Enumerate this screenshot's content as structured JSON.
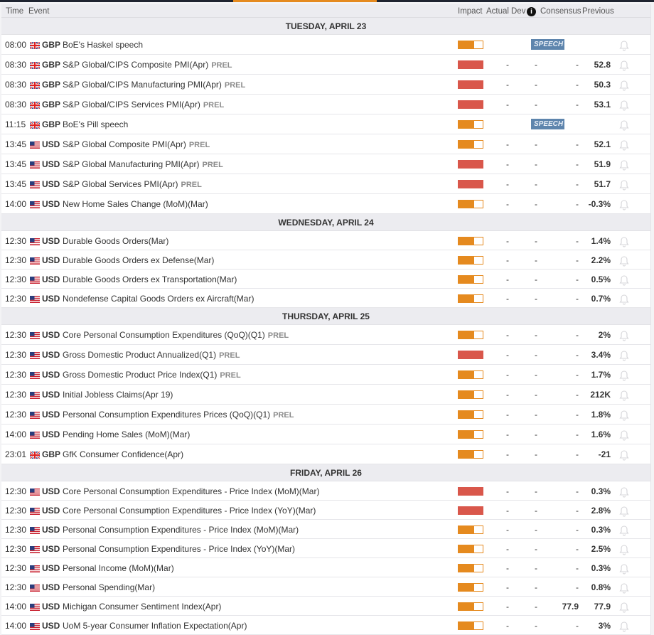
{
  "header": {
    "time": "Time",
    "event": "Event",
    "impact": "Impact",
    "actual": "Actual",
    "dev": "Dev",
    "info_icon": "i",
    "consensus": "Consensus",
    "previous": "Previous"
  },
  "colors": {
    "medium": "#e58a1f",
    "high": "#d9574b",
    "speech": "#5e85ad"
  },
  "days": [
    {
      "label": "TUESDAY, APRIL 23",
      "events": [
        {
          "time": "08:00",
          "currency": "GBP",
          "event": "BoE's Haskel speech",
          "tag": "",
          "impact": "medium",
          "speech": "SPEECH"
        },
        {
          "time": "08:30",
          "currency": "GBP",
          "event": "S&P Global/CIPS Composite PMI(Apr)",
          "tag": "PREL",
          "impact": "high",
          "actual": "-",
          "dev": "-",
          "consensus": "-",
          "previous": "52.8"
        },
        {
          "time": "08:30",
          "currency": "GBP",
          "event": "S&P Global/CIPS Manufacturing PMI(Apr)",
          "tag": "PREL",
          "impact": "high",
          "actual": "-",
          "dev": "-",
          "consensus": "-",
          "previous": "50.3"
        },
        {
          "time": "08:30",
          "currency": "GBP",
          "event": "S&P Global/CIPS Services PMI(Apr)",
          "tag": "PREL",
          "impact": "high",
          "actual": "-",
          "dev": "-",
          "consensus": "-",
          "previous": "53.1"
        },
        {
          "time": "11:15",
          "currency": "GBP",
          "event": "BoE's Pill speech",
          "tag": "",
          "impact": "medium",
          "speech": "SPEECH"
        },
        {
          "time": "13:45",
          "currency": "USD",
          "event": "S&P Global Composite PMI(Apr)",
          "tag": "PREL",
          "impact": "medium",
          "actual": "-",
          "dev": "-",
          "consensus": "-",
          "previous": "52.1"
        },
        {
          "time": "13:45",
          "currency": "USD",
          "event": "S&P Global Manufacturing PMI(Apr)",
          "tag": "PREL",
          "impact": "high",
          "actual": "-",
          "dev": "-",
          "consensus": "-",
          "previous": "51.9"
        },
        {
          "time": "13:45",
          "currency": "USD",
          "event": "S&P Global Services PMI(Apr)",
          "tag": "PREL",
          "impact": "high",
          "actual": "-",
          "dev": "-",
          "consensus": "-",
          "previous": "51.7"
        },
        {
          "time": "14:00",
          "currency": "USD",
          "event": "New Home Sales Change (MoM)(Mar)",
          "tag": "",
          "impact": "medium",
          "actual": "-",
          "dev": "-",
          "consensus": "-",
          "previous": "-0.3%"
        }
      ]
    },
    {
      "label": "WEDNESDAY, APRIL 24",
      "events": [
        {
          "time": "12:30",
          "currency": "USD",
          "event": "Durable Goods Orders(Mar)",
          "tag": "",
          "impact": "medium",
          "actual": "-",
          "dev": "-",
          "consensus": "-",
          "previous": "1.4%"
        },
        {
          "time": "12:30",
          "currency": "USD",
          "event": "Durable Goods Orders ex Defense(Mar)",
          "tag": "",
          "impact": "medium",
          "actual": "-",
          "dev": "-",
          "consensus": "-",
          "previous": "2.2%"
        },
        {
          "time": "12:30",
          "currency": "USD",
          "event": "Durable Goods Orders ex Transportation(Mar)",
          "tag": "",
          "impact": "medium",
          "actual": "-",
          "dev": "-",
          "consensus": "-",
          "previous": "0.5%"
        },
        {
          "time": "12:30",
          "currency": "USD",
          "event": "Nondefense Capital Goods Orders ex Aircraft(Mar)",
          "tag": "",
          "impact": "medium",
          "actual": "-",
          "dev": "-",
          "consensus": "-",
          "previous": "0.7%"
        }
      ]
    },
    {
      "label": "THURSDAY, APRIL 25",
      "events": [
        {
          "time": "12:30",
          "currency": "USD",
          "event": "Core Personal Consumption Expenditures (QoQ)(Q1)",
          "tag": "PREL",
          "impact": "medium",
          "actual": "-",
          "dev": "-",
          "consensus": "-",
          "previous": "2%"
        },
        {
          "time": "12:30",
          "currency": "USD",
          "event": "Gross Domestic Product Annualized(Q1)",
          "tag": "PREL",
          "impact": "high",
          "actual": "-",
          "dev": "-",
          "consensus": "-",
          "previous": "3.4%"
        },
        {
          "time": "12:30",
          "currency": "USD",
          "event": "Gross Domestic Product Price Index(Q1)",
          "tag": "PREL",
          "impact": "medium",
          "actual": "-",
          "dev": "-",
          "consensus": "-",
          "previous": "1.7%"
        },
        {
          "time": "12:30",
          "currency": "USD",
          "event": "Initial Jobless Claims(Apr 19)",
          "tag": "",
          "impact": "medium",
          "actual": "-",
          "dev": "-",
          "consensus": "-",
          "previous": "212K"
        },
        {
          "time": "12:30",
          "currency": "USD",
          "event": "Personal Consumption Expenditures Prices (QoQ)(Q1)",
          "tag": "PREL",
          "impact": "medium",
          "actual": "-",
          "dev": "-",
          "consensus": "-",
          "previous": "1.8%"
        },
        {
          "time": "14:00",
          "currency": "USD",
          "event": "Pending Home Sales (MoM)(Mar)",
          "tag": "",
          "impact": "medium",
          "actual": "-",
          "dev": "-",
          "consensus": "-",
          "previous": "1.6%"
        },
        {
          "time": "23:01",
          "currency": "GBP",
          "event": "GfK Consumer Confidence(Apr)",
          "tag": "",
          "impact": "medium",
          "actual": "-",
          "dev": "-",
          "consensus": "-",
          "previous": "-21"
        }
      ]
    },
    {
      "label": "FRIDAY, APRIL 26",
      "events": [
        {
          "time": "12:30",
          "currency": "USD",
          "event": "Core Personal Consumption Expenditures - Price Index (MoM)(Mar)",
          "tag": "",
          "impact": "high",
          "actual": "-",
          "dev": "-",
          "consensus": "-",
          "previous": "0.3%"
        },
        {
          "time": "12:30",
          "currency": "USD",
          "event": "Core Personal Consumption Expenditures - Price Index (YoY)(Mar)",
          "tag": "",
          "impact": "high",
          "actual": "-",
          "dev": "-",
          "consensus": "-",
          "previous": "2.8%"
        },
        {
          "time": "12:30",
          "currency": "USD",
          "event": "Personal Consumption Expenditures - Price Index (MoM)(Mar)",
          "tag": "",
          "impact": "medium",
          "actual": "-",
          "dev": "-",
          "consensus": "-",
          "previous": "0.3%"
        },
        {
          "time": "12:30",
          "currency": "USD",
          "event": "Personal Consumption Expenditures - Price Index (YoY)(Mar)",
          "tag": "",
          "impact": "medium",
          "actual": "-",
          "dev": "-",
          "consensus": "-",
          "previous": "2.5%"
        },
        {
          "time": "12:30",
          "currency": "USD",
          "event": "Personal Income (MoM)(Mar)",
          "tag": "",
          "impact": "medium",
          "actual": "-",
          "dev": "-",
          "consensus": "-",
          "previous": "0.3%"
        },
        {
          "time": "12:30",
          "currency": "USD",
          "event": "Personal Spending(Mar)",
          "tag": "",
          "impact": "medium",
          "actual": "-",
          "dev": "-",
          "consensus": "-",
          "previous": "0.8%"
        },
        {
          "time": "14:00",
          "currency": "USD",
          "event": "Michigan Consumer Sentiment Index(Apr)",
          "tag": "",
          "impact": "medium",
          "actual": "-",
          "dev": "-",
          "consensus": "77.9",
          "previous": "77.9"
        },
        {
          "time": "14:00",
          "currency": "USD",
          "event": "UoM 5-year Consumer Inflation Expectation(Apr)",
          "tag": "",
          "impact": "medium",
          "actual": "-",
          "dev": "-",
          "consensus": "-",
          "previous": "3%"
        }
      ]
    }
  ]
}
